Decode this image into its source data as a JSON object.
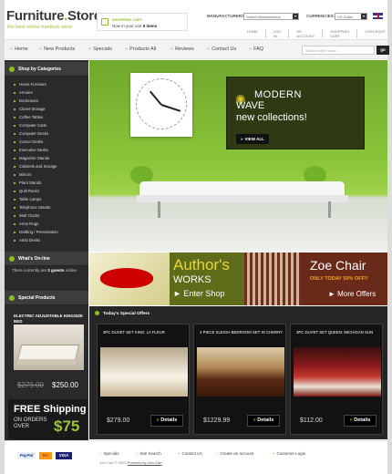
{
  "header": {
    "logo_main": "Furniture",
    "logo_dot": ".",
    "logo_store": "Store",
    "tagline": "the best online furniture store",
    "cart_title": "SHOPPING CART",
    "cart_prefix": "Now in your cart",
    "cart_count": "5 items",
    "manufacturers_label": "MANUFACTURERS:",
    "manufacturers_value": "Select Manufacturers",
    "currencies_label": "CURRENCIES:",
    "currencies_value": "US Dollar",
    "top_links": [
      "HOME",
      "LOG IN",
      "MY ACCOUNT",
      "SHOPPING CART",
      "CHECKOUT"
    ]
  },
  "nav": {
    "items": [
      "Home",
      "New Products",
      "Specials",
      "Products All",
      "Reviews",
      "Contact Us",
      "FAQ"
    ],
    "search_placeholder": "Search entire store...",
    "go_label": "go"
  },
  "sidebar": {
    "categories_title": "Shop by Categories",
    "categories": [
      "Home Furniture",
      "Armoire",
      "Bookcases",
      "Closet Storage",
      "Coffee Tables",
      "Computer Carts",
      "Computer Desks",
      "Corner Desks",
      "Executive Desks",
      "Magazine Stands",
      "Cabinets and Storage",
      "Mirrors",
      "Plant Stands",
      "Quilt Racks",
      "Table Lamps",
      "Telephone Stands",
      "Wall Clocks",
      "Arms Rugs",
      "Drafting / Presentation",
      "Artist Desks"
    ],
    "online_title": "What's On-line",
    "online_prefix": "There currently are",
    "online_count": "2 guests",
    "online_suffix": "online.",
    "specials_title": "Special Products",
    "special_product": "ELECTRIC ADJUSTABLE KINGSIZE BED",
    "special_old_price": "$279.00",
    "special_new_price": "$250.00",
    "freeship_title": "FREE Shipping",
    "freeship_line1": "ON ORDERS",
    "freeship_line2": "OVER",
    "freeship_amount": "$75"
  },
  "hero": {
    "line1": "MODERN",
    "line2": "WAVE",
    "line3": "new collections!",
    "button": "VIEW ALL"
  },
  "promo": {
    "author_title": "Author's",
    "author_sub": "WORKS",
    "author_cta": "Enter Shop",
    "zoe_title": "Zoe Chair",
    "zoe_sub_prefix": "ONLY TODAY",
    "zoe_off": "50% OFF!!",
    "zoe_cta": "More Offers"
  },
  "specials": {
    "title": "Today's Special Offers",
    "items": [
      {
        "name": "3PC DUVET SET KING: LA FLEUR",
        "price": "$279.00",
        "button": "Details"
      },
      {
        "name": "4 PIECE SLEIGH BEDROOM SET IN CHERRY",
        "price": "$1229.99",
        "button": "Details"
      },
      {
        "name": "3PC DUVET SET QUEEN: MICHIGAN SUN",
        "price": "$112.00",
        "button": "Details"
      }
    ]
  },
  "footer": {
    "payments": [
      "PayPal",
      "MC",
      "VISA"
    ],
    "links": [
      "Specials",
      "Site Search",
      "Contact Us",
      "Create an account",
      "Customer Login"
    ],
    "copyright": "Zen Cart © 2009",
    "powered": "Powered by Zen Cart"
  },
  "colors": {
    "accent": "#8dbf1f",
    "dark": "#2a2a2a",
    "hero_green": "#8cc63a"
  }
}
